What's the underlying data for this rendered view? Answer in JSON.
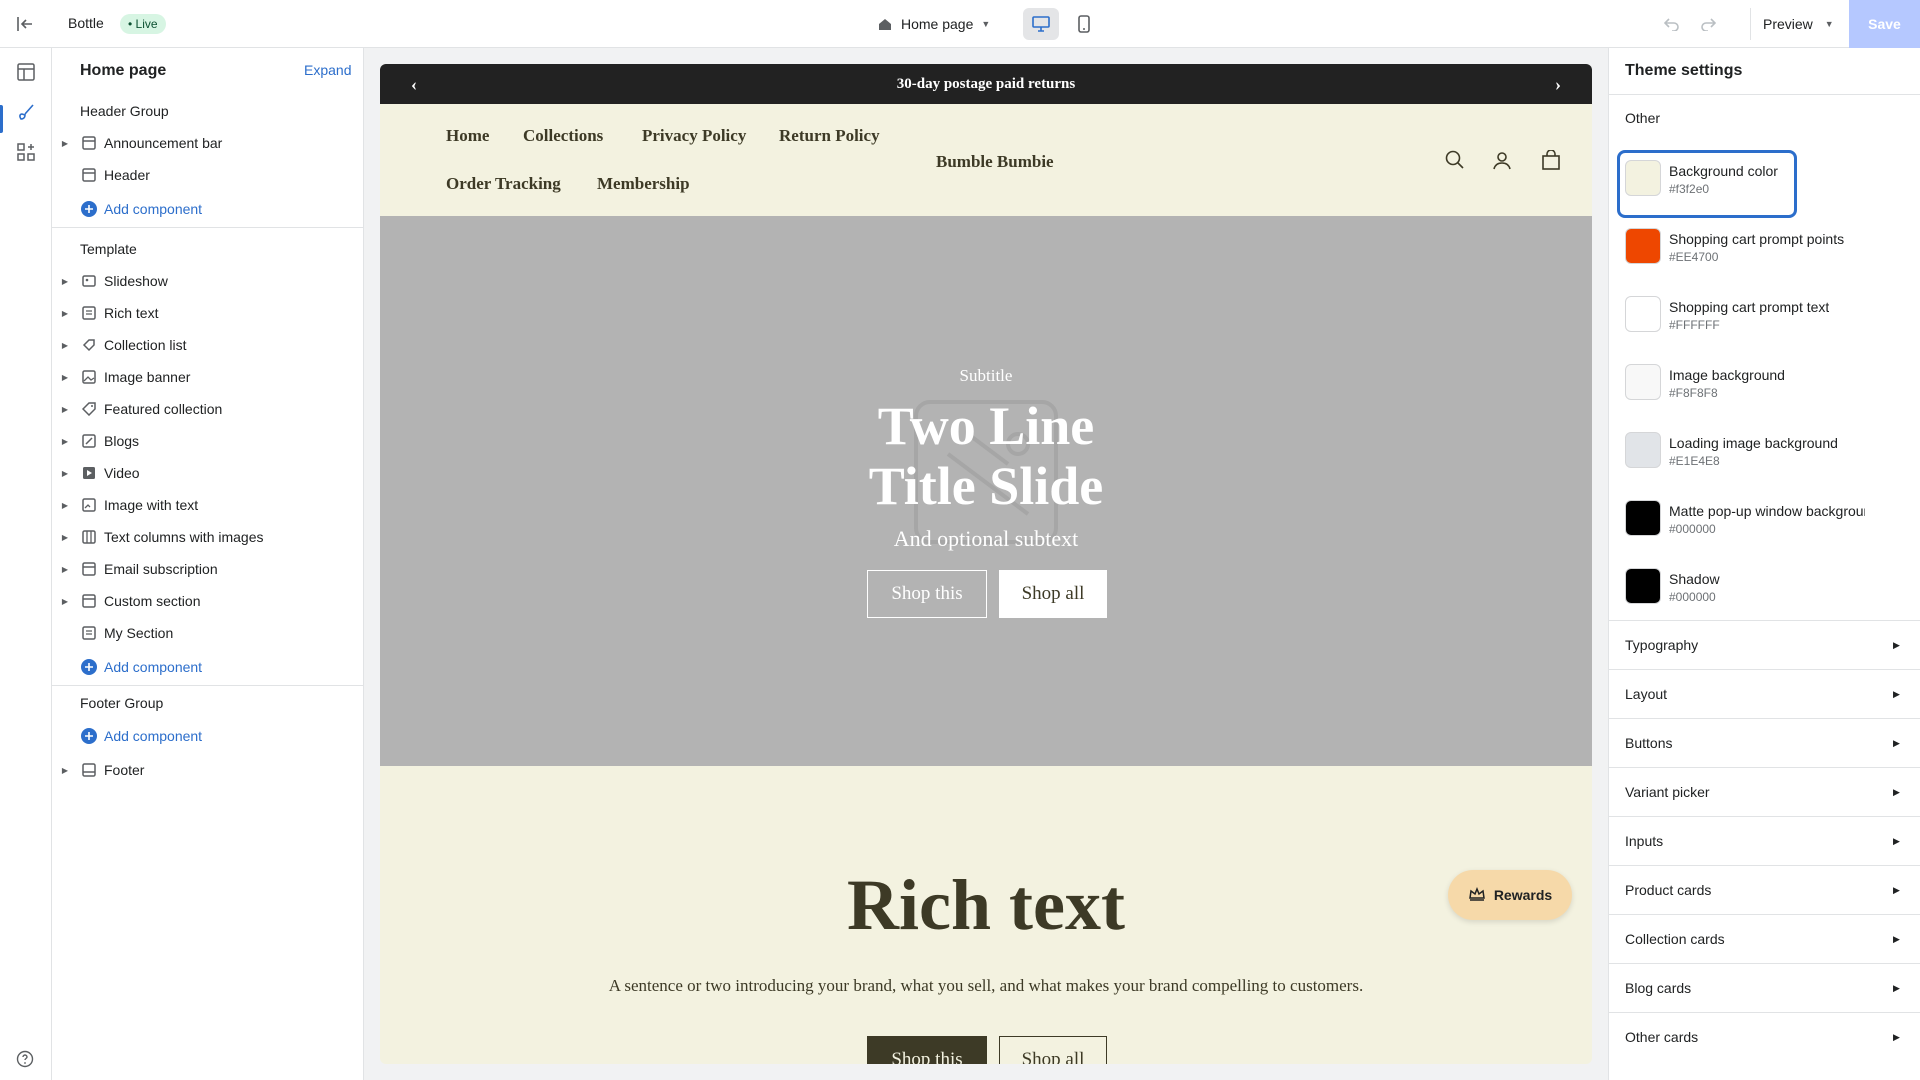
{
  "topbar": {
    "store_name": "Bottle",
    "live_badge": "• Live",
    "page_picker_label": "Home page",
    "preview_label": "Preview",
    "save_label": "Save"
  },
  "sidebar": {
    "title": "Home page",
    "expand_label": "Expand",
    "header_group": {
      "title": "Header Group",
      "items": [
        {
          "label": "Announcement bar",
          "icon": "section-icon",
          "has_caret": true
        },
        {
          "label": "Header",
          "icon": "section-icon",
          "has_caret": false
        }
      ],
      "add_label": "Add component"
    },
    "template": {
      "title": "Template",
      "items": [
        {
          "label": "Slideshow",
          "icon": "slideshow-icon"
        },
        {
          "label": "Rich text",
          "icon": "text-block-icon"
        },
        {
          "label": "Collection list",
          "icon": "collection-icon"
        },
        {
          "label": "Image banner",
          "icon": "image-icon"
        },
        {
          "label": "Featured collection",
          "icon": "tag-icon"
        },
        {
          "label": "Blogs",
          "icon": "blog-icon"
        },
        {
          "label": "Video",
          "icon": "video-icon"
        },
        {
          "label": "Image with text",
          "icon": "image-text-icon"
        },
        {
          "label": "Text columns with images",
          "icon": "columns-icon"
        },
        {
          "label": "Email subscription",
          "icon": "section-icon"
        },
        {
          "label": "Custom section",
          "icon": "section-icon"
        },
        {
          "label": "My Section",
          "icon": "text-block-icon"
        }
      ],
      "add_label": "Add component"
    },
    "footer_group": {
      "title": "Footer Group",
      "add_label": "Add component",
      "items": [
        {
          "label": "Footer",
          "icon": "section-icon"
        }
      ]
    }
  },
  "preview": {
    "announcement": "30-day postage paid returns",
    "nav_links": [
      "Home",
      "Collections",
      "Privacy Policy",
      "Return Policy",
      "Order Tracking",
      "Membership"
    ],
    "brand": "Bumble Bumbie",
    "hero": {
      "subtitle": "Subtitle",
      "title_line1": "Two Line",
      "title_line2": "Title Slide",
      "text": "And optional subtext",
      "button1": "Shop this",
      "button2": "Shop all"
    },
    "rich_text": {
      "title": "Rich text",
      "body": "A sentence or two introducing your brand, what you sell, and what makes your brand compelling to customers.",
      "button1": "Shop this",
      "button2": "Shop all"
    },
    "rewards_label": "Rewards",
    "colors": {
      "background": "#f3f2e0",
      "dark": "#3d3a26",
      "hero_bg": "#b3b3b3",
      "announce_bg": "#222222"
    }
  },
  "theme_settings": {
    "title": "Theme settings",
    "section_title": "Other",
    "colors": [
      {
        "name": "Background color",
        "hex": "#f3f2e0",
        "selected": true
      },
      {
        "name": "Shopping cart prompt points",
        "hex": "#EE4700"
      },
      {
        "name": "Shopping cart prompt text",
        "hex": "#FFFFFF"
      },
      {
        "name": "Image background",
        "hex": "#F8F8F8"
      },
      {
        "name": "Loading image background",
        "hex": "#E1E4E8"
      },
      {
        "name": "Matte pop-up window background",
        "hex": "#000000"
      },
      {
        "name": "Shadow",
        "hex": "#000000"
      }
    ],
    "accordions": [
      "Typography",
      "Layout",
      "Buttons",
      "Variant picker",
      "Inputs",
      "Product cards",
      "Collection cards",
      "Blog cards",
      "Other cards"
    ]
  }
}
